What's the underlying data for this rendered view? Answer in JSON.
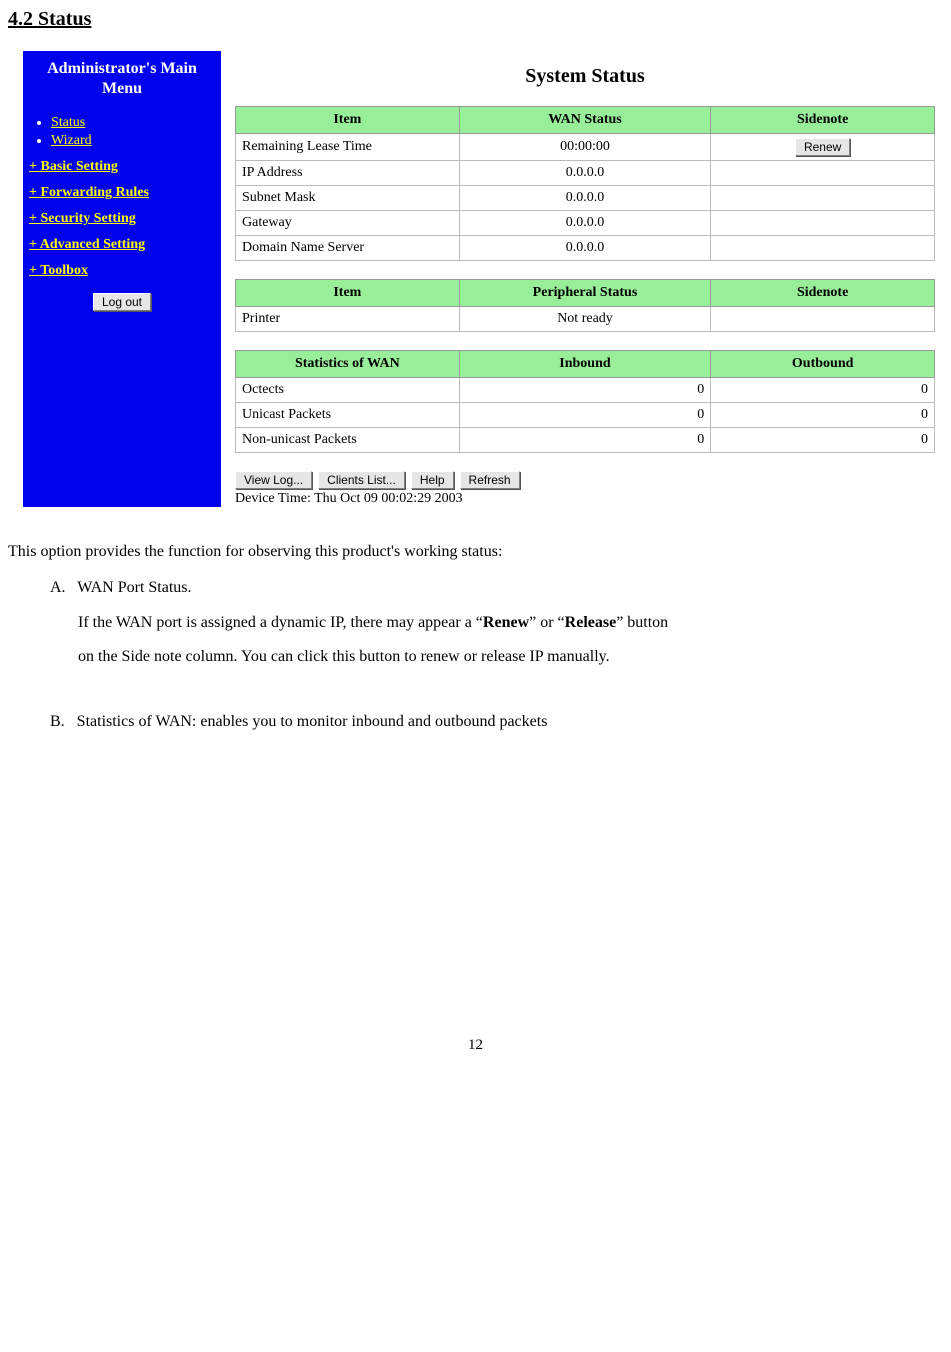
{
  "doc": {
    "section_heading": "4.2 Status",
    "page_number": "12",
    "intro": "This option provides the function for observing this product's working status:",
    "itemA_label": "A.",
    "itemA_title": "WAN Port Status.",
    "itemA_line1_a": "If the WAN port is assigned a dynamic IP, there may appear a “",
    "itemA_bold1": "Renew",
    "itemA_line1_b": "” or “",
    "itemA_bold2": "Release",
    "itemA_line1_c": "” button",
    "itemA_line2": "on the Side note column. You can click this button to renew or release IP manually.",
    "itemB_label": "B.",
    "itemB_text": "Statistics of WAN: enables you to monitor inbound and outbound packets"
  },
  "sidebar": {
    "title": "Administrator's Main Menu",
    "items": [
      {
        "label": "Status"
      },
      {
        "label": "Wizard"
      }
    ],
    "sections": [
      {
        "label": "+ Basic Setting"
      },
      {
        "label": "+ Forwarding Rules"
      },
      {
        "label": "+ Security Setting"
      },
      {
        "label": "+ Advanced Setting"
      },
      {
        "label": "+ Toolbox"
      }
    ],
    "logout_label": "Log out"
  },
  "main": {
    "title": "System Status",
    "wan_table": {
      "headers": [
        "Item",
        "WAN Status",
        "Sidenote"
      ],
      "rows": [
        {
          "item": "Remaining Lease Time",
          "value": "00:00:00",
          "sidenote_button": "Renew"
        },
        {
          "item": "IP Address",
          "value": "0.0.0.0"
        },
        {
          "item": "Subnet Mask",
          "value": "0.0.0.0"
        },
        {
          "item": "Gateway",
          "value": "0.0.0.0"
        },
        {
          "item": "Domain Name Server",
          "value": "0.0.0.0"
        }
      ]
    },
    "periph_table": {
      "headers": [
        "Item",
        "Peripheral Status",
        "Sidenote"
      ],
      "rows": [
        {
          "item": "Printer",
          "value": "Not ready"
        }
      ]
    },
    "stats_table": {
      "headers": [
        "Statistics of WAN",
        "Inbound",
        "Outbound"
      ],
      "rows": [
        {
          "item": "Octects",
          "in": "0",
          "out": "0"
        },
        {
          "item": "Unicast Packets",
          "in": "0",
          "out": "0"
        },
        {
          "item": "Non-unicast Packets",
          "in": "0",
          "out": "0"
        }
      ]
    },
    "buttons": {
      "view_log": "View Log...",
      "clients_list": "Clients List...",
      "help": "Help",
      "refresh": "Refresh"
    },
    "device_time": "Device Time: Thu Oct 09 00:02:29 2003"
  }
}
